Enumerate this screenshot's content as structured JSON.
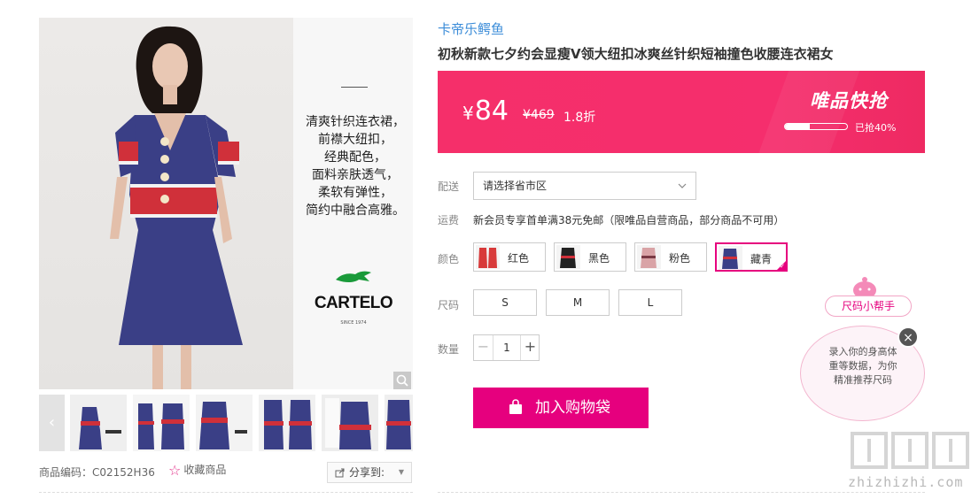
{
  "gallery": {
    "promo_lines": "清爽针织连衣裙，\n前襟大纽扣，\n经典配色，\n面料亲肤透气，\n柔软有弹性，\n简约中融合高雅。",
    "brand_logo": "CARTELO",
    "brand_since": "SINCE 1974",
    "thumbnail_count": 6,
    "prev_arrow": "‹"
  },
  "meta": {
    "product_code": "商品编码：C02152H36",
    "favorite_label": "收藏商品",
    "share_label": "分享到:"
  },
  "product": {
    "brand": "卡帝乐鳄鱼",
    "title": "初秋新款七夕约会显瘦V领大纽扣冰爽丝针织短袖撞色收腰连衣裙女"
  },
  "price": {
    "currency": "¥",
    "current": "84",
    "original": "¥469",
    "discount": "1.8折",
    "flash_title": "唯品快抢",
    "sold_percent": 40,
    "sold_text": "已抢40%"
  },
  "delivery": {
    "label": "配送",
    "region_placeholder": "请选择省市区"
  },
  "shipping": {
    "label": "运费",
    "text": "新会员专享首单满38元免邮（限唯品自营商品，部分商品不可用）"
  },
  "colors": {
    "label": "颜色",
    "options": [
      "红色",
      "黑色",
      "粉色",
      "藏青"
    ],
    "selected": "藏青"
  },
  "sizes": {
    "label": "尺码",
    "options": [
      "S",
      "M",
      "L"
    ]
  },
  "quantity": {
    "label": "数量",
    "value": "1",
    "minus": "−",
    "plus": "+"
  },
  "cart": {
    "label": "加入购物袋"
  },
  "size_helper": {
    "title": "尺码小帮手",
    "text": "录入你的身高体\n重等数据，为你\n精准推荐尺码",
    "close": "×"
  },
  "watermark": {
    "text": "zhizhizhi.com"
  },
  "colors_theme": {
    "accent": "#e6007e",
    "banner": "#f52f6a",
    "link": "#3b8cd8"
  }
}
